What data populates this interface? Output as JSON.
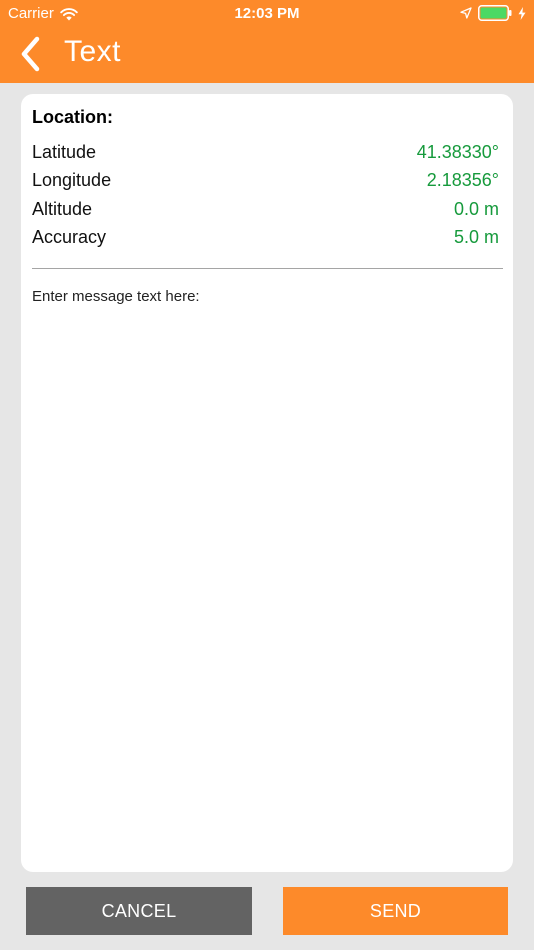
{
  "status_bar": {
    "carrier": "Carrier",
    "time": "12:03 PM"
  },
  "nav": {
    "title": "Text"
  },
  "location": {
    "heading": "Location:",
    "rows": [
      {
        "label": "Latitude",
        "value": "41.38330°"
      },
      {
        "label": "Longitude",
        "value": "2.18356°"
      },
      {
        "label": "Altitude",
        "value": "0.0 m"
      },
      {
        "label": "Accuracy",
        "value": "5.0 m"
      }
    ]
  },
  "message": {
    "placeholder": "Enter message text here:",
    "value": ""
  },
  "actions": {
    "cancel_label": "CANCEL",
    "send_label": "SEND"
  },
  "colors": {
    "accent": "#fd8a2a",
    "value_green": "#169a3c",
    "cancel_gray": "#636363",
    "background": "#e6e6e6"
  },
  "icons": {
    "wifi": "wifi-icon",
    "location_arrow": "location-arrow-icon",
    "battery": "battery-icon",
    "charging": "charging-bolt-icon",
    "back": "chevron-left-icon"
  }
}
